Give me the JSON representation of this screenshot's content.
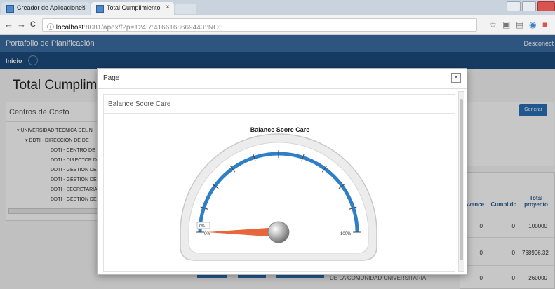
{
  "browser": {
    "tabs": [
      {
        "label": "Creador de Aplicaciones",
        "close": "×"
      },
      {
        "label": "Total Cumplimiento",
        "close": "×"
      }
    ],
    "back": "←",
    "forward": "→",
    "reload": "C",
    "info": "ⓘ",
    "url_host": "localhost",
    "url_path": ":8081/apex/f?p=124:7:4166168669443::NO::"
  },
  "app": {
    "title": "Portafolio de Planificación",
    "disconnect": "Desconect",
    "nav_home": "Inicio",
    "page_title": "Total Cumplimien",
    "cost_centers_title": "Centros de Costo",
    "tree": [
      {
        "text": "▾   UNIVERSIDAD TECNICA DEL N"
      },
      {
        "text": "▾   DDTI - DIRECCIÓN DE DE"
      },
      {
        "text": "DDTI - CENTRO DE CA"
      },
      {
        "text": "DDTI - DIRECTOR DE I"
      },
      {
        "text": "DDTI - GESTIÓN DE IN"
      },
      {
        "text": "DDTI - GESTIÓN DE A"
      },
      {
        "text": "DDTI - SECRETARIA"
      },
      {
        "text": "DDTI - GESTIÓN DE P"
      }
    ],
    "generate_button": "Generar",
    "table": {
      "headers": [
        "Avance",
        "Cumplido",
        "Total proyecto"
      ],
      "rows": [
        [
          "0",
          "0",
          "100000"
        ],
        [
          "0",
          "0",
          "768996,32"
        ],
        [
          "0",
          "0",
          "260000"
        ]
      ]
    },
    "background_text": "DE LA COMUNIDAD UNIVERSITARIA"
  },
  "modal": {
    "title": "Page",
    "close": "×",
    "region_title": "Balance Score Care",
    "chart_title": "Balance Score Care"
  },
  "chart_data": {
    "type": "gauge",
    "title": "Balance Score Care",
    "min": 0,
    "max": 100,
    "value": 0,
    "min_label": "0%",
    "max_label": "100%",
    "value_label": "0%",
    "colors": {
      "band": "#2f7fc6",
      "needle": "#e8663c",
      "frame": "#e9e9e9"
    }
  }
}
